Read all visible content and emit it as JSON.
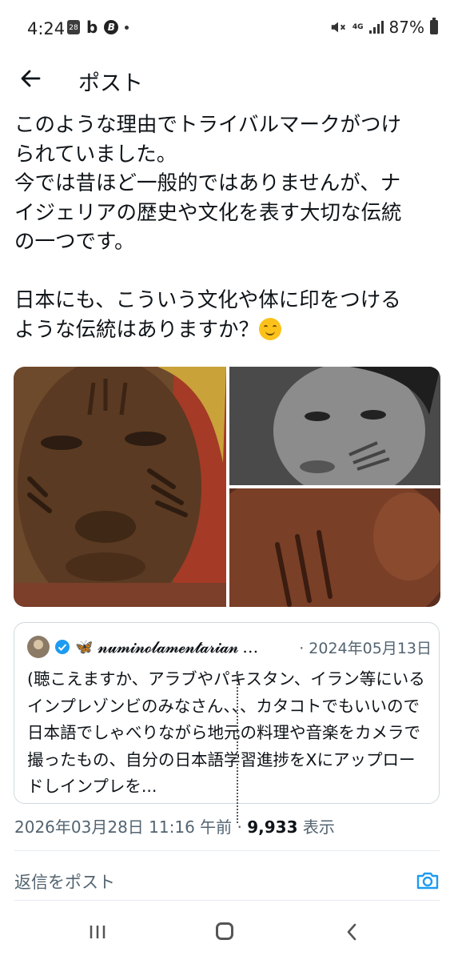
{
  "status_bar": {
    "time": "4:24",
    "calendar_day": "28",
    "network": "4G",
    "battery": "87%"
  },
  "header": {
    "title": "ポスト"
  },
  "post": {
    "text_lines": [
      "このような理由でトライバルマークがつけ",
      "られていました。",
      "今では昔ほど一般的ではありませんが、ナ",
      "イジェリアの歴史や文化を表す大切な伝統",
      "の一つです。",
      "",
      "日本にも、こういう文化や体に印をつける",
      "ような伝統はありますか？"
    ],
    "images": [
      "photo of a woman with tribal facial scars",
      "black and white photo of a child with cheek scars",
      "close-up photo of a cheek with scar lines"
    ]
  },
  "quote": {
    "name": "𝓷𝓾𝓶𝓲𝓷𝓸𝓵𝓪𝓶𝓮𝓷𝓽𝓪𝓻𝓲𝓪𝓷 …",
    "date": "· 2024年05月13日",
    "text": "(聴こえますか、アラブやパキスタン、イラン等にいるインプレゾンビのみなさん、、、カタコトでもいいので日本語でしゃべりながら地元の料理や音楽をカメラで撮ったもの、自分の日本語学習進捗をXにアップロードしインプレを..."
  },
  "meta": {
    "timestamp": "2026年03月28日 11:16 午前 · ",
    "views": "9,933",
    "views_label": " 表示"
  },
  "reply": {
    "placeholder": "返信をポスト"
  },
  "icons": [
    "calendar-icon",
    "b-app-icon",
    "circle-b-icon",
    "mute-icon",
    "signal-icon",
    "battery-icon",
    "back-arrow-icon",
    "verified-icon",
    "butterfly-icon",
    "smile-emoji-icon",
    "camera-icon",
    "recent-apps-icon",
    "home-icon",
    "back-icon"
  ],
  "colors": {
    "text": "#0f1419",
    "secondary": "#536471",
    "accent": "#1d9bf0",
    "border": "#cfd9de"
  }
}
